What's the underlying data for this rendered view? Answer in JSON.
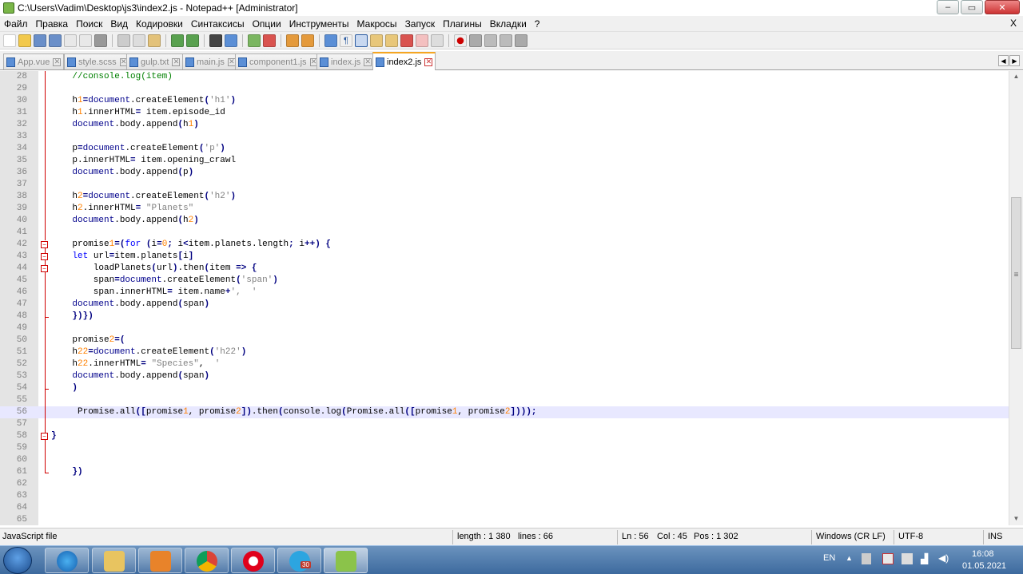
{
  "window": {
    "title": "C:\\Users\\Vadim\\Desktop\\js3\\index2.js - Notepad++ [Administrator]",
    "minimize_glyph": "–",
    "maximize_glyph": "▭",
    "close_glyph": "✕"
  },
  "menu": {
    "items": [
      "Файл",
      "Правка",
      "Поиск",
      "Вид",
      "Кодировки",
      "Синтаксисы",
      "Опции",
      "Инструменты",
      "Макросы",
      "Запуск",
      "Плагины",
      "Вкладки",
      "?"
    ],
    "close_label": "X"
  },
  "tabs": [
    {
      "label": "App.vue",
      "active": false
    },
    {
      "label": "style.scss",
      "active": false
    },
    {
      "label": "gulp.txt",
      "active": false
    },
    {
      "label": "main.js",
      "active": false
    },
    {
      "label": "component1.js",
      "active": false
    },
    {
      "label": "index.js",
      "active": false
    },
    {
      "label": "index2.js",
      "active": true
    }
  ],
  "editor": {
    "lines": [
      {
        "n": "28",
        "code": "    //console.log(item)"
      },
      {
        "n": "29",
        "code": ""
      },
      {
        "n": "30",
        "code": "    h1=document.createElement('h1')"
      },
      {
        "n": "31",
        "code": "    h1.innerHTML= item.episode_id"
      },
      {
        "n": "32",
        "code": "    document.body.append(h1)"
      },
      {
        "n": "33",
        "code": ""
      },
      {
        "n": "34",
        "code": "    p=document.createElement('p')"
      },
      {
        "n": "35",
        "code": "    p.innerHTML= item.opening_crawl"
      },
      {
        "n": "36",
        "code": "    document.body.append(p)"
      },
      {
        "n": "37",
        "code": ""
      },
      {
        "n": "38",
        "code": "    h2=document.createElement('h2')"
      },
      {
        "n": "39",
        "code": "    h2.innerHTML= \"Planets\""
      },
      {
        "n": "40",
        "code": "    document.body.append(h2)"
      },
      {
        "n": "41",
        "code": ""
      },
      {
        "n": "42",
        "code": "    promise1=(for (i=0; i<item.planets.length; i++) {"
      },
      {
        "n": "43",
        "code": "    let url=item.planets[i]"
      },
      {
        "n": "44",
        "code": "        loadPlanets(url).then(item => {"
      },
      {
        "n": "45",
        "code": "        span=document.createElement('span')"
      },
      {
        "n": "46",
        "code": "        span.innerHTML= item.name+',  '"
      },
      {
        "n": "47",
        "code": "    document.body.append(span)"
      },
      {
        "n": "48",
        "code": "    })})"
      },
      {
        "n": "49",
        "code": ""
      },
      {
        "n": "50",
        "code": "    promise2=("
      },
      {
        "n": "51",
        "code": "    h22=document.createElement('h22')"
      },
      {
        "n": "52",
        "code": "    h22.innerHTML= \"Species\",  '"
      },
      {
        "n": "53",
        "code": "    document.body.append(span)"
      },
      {
        "n": "54",
        "code": "    )"
      },
      {
        "n": "55",
        "code": ""
      },
      {
        "n": "56",
        "code": "     Promise.all([promise1, promise2]).then(console.log(Promise.all([promise1, promise2])));"
      },
      {
        "n": "57",
        "code": ""
      },
      {
        "n": "58",
        "code": "}"
      },
      {
        "n": "59",
        "code": ""
      },
      {
        "n": "60",
        "code": ""
      },
      {
        "n": "61",
        "code": "    })"
      },
      {
        "n": "62",
        "code": ""
      },
      {
        "n": "63",
        "code": ""
      },
      {
        "n": "64",
        "code": ""
      },
      {
        "n": "65",
        "code": ""
      }
    ],
    "current_line": "56"
  },
  "status": {
    "file_type": "JavaScript file",
    "length": "length : 1 380",
    "lines": "lines : 66",
    "ln": "Ln : 56",
    "col": "Col : 45",
    "pos": "Pos : 1 302",
    "eol": "Windows (CR LF)",
    "encoding": "UTF-8",
    "mode": "INS"
  },
  "taskbar": {
    "lang": "EN",
    "time": "16:08",
    "date": "01.05.2021",
    "telegram_badge": "30",
    "apps": [
      "start-button",
      "ie-icon",
      "explorer-icon",
      "media-player-icon",
      "chrome-icon",
      "opera-icon",
      "telegram-icon",
      "notepadpp-icon"
    ]
  }
}
